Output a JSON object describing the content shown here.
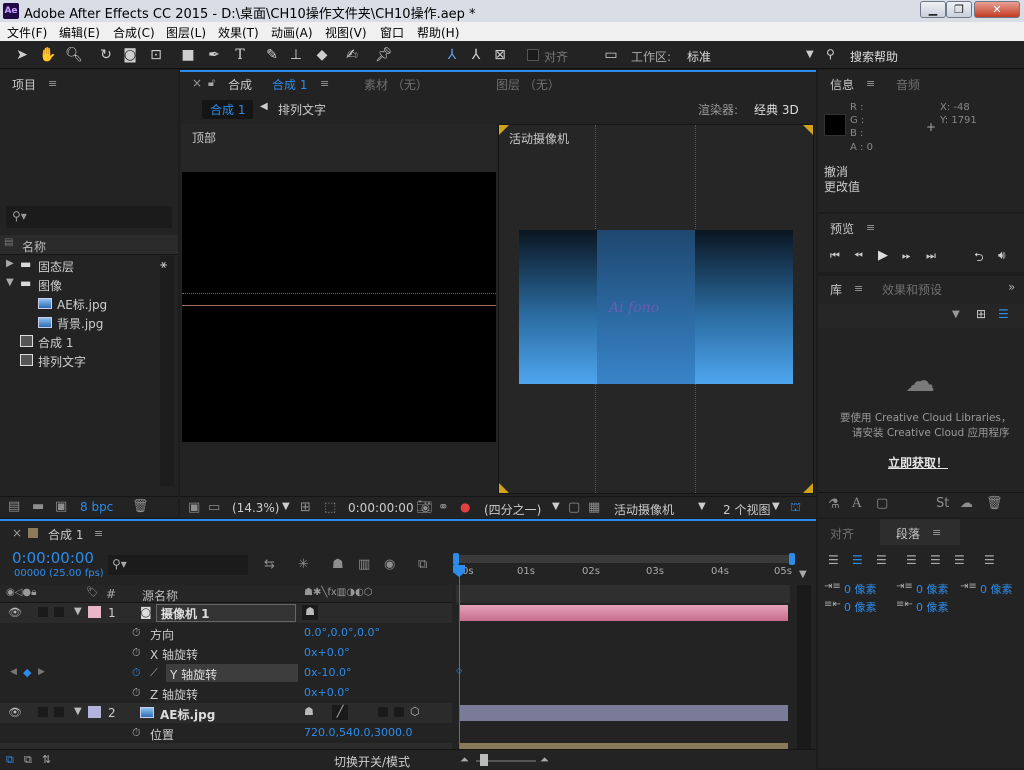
{
  "window": {
    "app_badge": "Ae",
    "title": "Adobe After Effects CC 2015 - D:\\桌面\\CH10操作文件夹\\CH10操作.aep *"
  },
  "menu": [
    "文件(F)",
    "编辑(E)",
    "合成(C)",
    "图层(L)",
    "效果(T)",
    "动画(A)",
    "视图(V)",
    "窗口",
    "帮助(H)"
  ],
  "toolbar": {
    "snap_label": "对齐",
    "workspace_label": "工作区:",
    "workspace_value": "标准",
    "search_help": "搜索帮助"
  },
  "project": {
    "tab": "项目",
    "search_placeholder": "",
    "column_name": "名称",
    "items": [
      {
        "name": "固态层",
        "kind": "folder",
        "expanded": false
      },
      {
        "name": "图像",
        "kind": "folder",
        "expanded": true
      },
      {
        "name": "AE标.jpg",
        "kind": "image"
      },
      {
        "name": "背景.jpg",
        "kind": "image"
      },
      {
        "name": "合成 1",
        "kind": "comp"
      },
      {
        "name": "排列文字",
        "kind": "comp"
      }
    ],
    "bpc": "8 bpc"
  },
  "comp_viewer": {
    "tab_prefix": "合成",
    "tab_name": "合成 1",
    "footage_tab": "素材 （无）",
    "layer_tab": "图层 （无）",
    "crumb_active": "合成 1",
    "crumb_next": "排列文字",
    "renderer_label": "渲染器:",
    "renderer_value": "经典 3D",
    "view_top": "顶部",
    "view_camera": "活动摄像机",
    "logo_text": "Ai fono",
    "zoom": "(14.3%)",
    "timecode": "0:00:00:00",
    "resolution": "(四分之一)",
    "camera": "活动摄像机",
    "view_count": "2 个视图"
  },
  "info": {
    "tab": "信息",
    "tab2": "音频",
    "r": "R :",
    "g": "G :",
    "b": "B :",
    "a": "A : 0",
    "x": "X: -48",
    "y": "Y: 1791",
    "undo": "撤消",
    "undo_detail": "更改值"
  },
  "preview": {
    "tab": "预览"
  },
  "library": {
    "tab": "库",
    "tab2": "效果和预设",
    "message1": "要使用 Creative Cloud Libraries，",
    "message2": "请安装 Creative Cloud 应用程序",
    "link": "立即获取！"
  },
  "paragraph": {
    "tab_align": "对齐",
    "tab_para": "段落",
    "fields": [
      "0 像素",
      "0 像素",
      "0 像素",
      "0 像素",
      "0 像素"
    ]
  },
  "timeline": {
    "tab": "合成 1",
    "timecode": "0:00:00:00",
    "fps": "00000 (25.00 fps)",
    "col_num": "#",
    "col_source": "源名称",
    "ruler": [
      "0s",
      "01s",
      "02s",
      "03s",
      "04s",
      "05s"
    ],
    "rows": [
      {
        "num": "1",
        "name": "摄像机 1",
        "kind": "layer",
        "color": "#e9b5c7"
      },
      {
        "num": "",
        "name": "方向",
        "kind": "prop",
        "value": "0.0°,0.0°,0.0°"
      },
      {
        "num": "",
        "name": "X 轴旋转",
        "kind": "prop",
        "value": "0x+0.0°"
      },
      {
        "num": "",
        "name": "Y 轴旋转",
        "kind": "prop",
        "value": "0x-10.0°"
      },
      {
        "num": "",
        "name": "Z 轴旋转",
        "kind": "prop",
        "value": "0x+0.0°"
      },
      {
        "num": "2",
        "name": "AE标.jpg",
        "kind": "layer",
        "color": "#b3b3dc"
      },
      {
        "num": "",
        "name": "位置",
        "kind": "prop",
        "value": "720.0,540.0,3000.0"
      }
    ],
    "footer": "切换开关/模式"
  },
  "colors": {
    "accent": "#2d8ceb",
    "camera_bar": "#d46a8e",
    "layer_bar": "#7a7a99",
    "playhead": "#e03a3a",
    "frame_yellow": "#d1a21c"
  }
}
